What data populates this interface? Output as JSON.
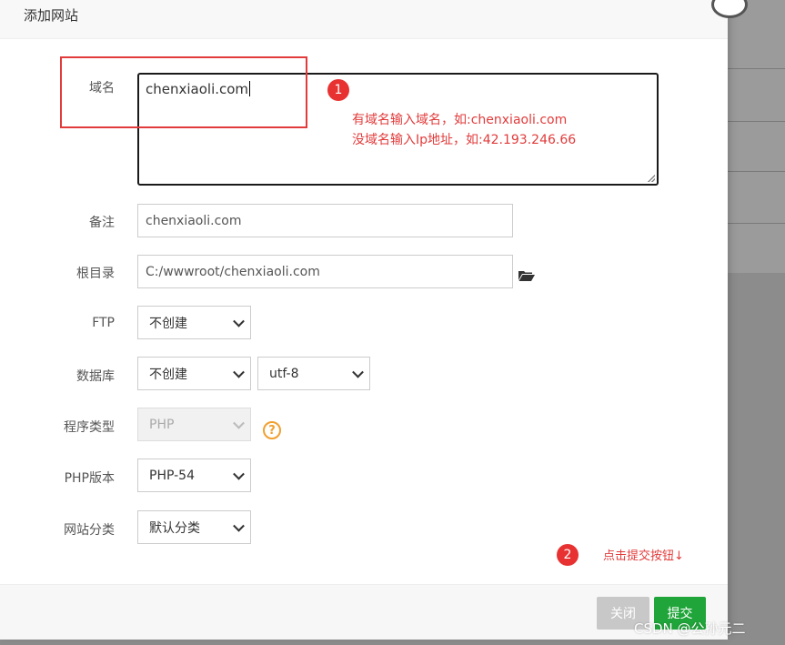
{
  "dialog": {
    "title": "添加网站"
  },
  "form": {
    "domain": {
      "label": "域名",
      "value": "chenxiaoli.com"
    },
    "remark": {
      "label": "备注",
      "value": "chenxiaoli.com"
    },
    "root": {
      "label": "根目录",
      "value": "C:/wwwroot/chenxiaoli.com"
    },
    "ftp": {
      "label": "FTP",
      "selected": "不创建"
    },
    "database": {
      "label": "数据库",
      "selected": "不创建",
      "charset": "utf-8"
    },
    "program_type": {
      "label": "程序类型",
      "selected": "PHP"
    },
    "php_version": {
      "label": "PHP版本",
      "selected": "PHP-54"
    },
    "category": {
      "label": "网站分类",
      "selected": "默认分类"
    }
  },
  "annotations": {
    "badge1": "1",
    "note1_line1": "有域名输入域名，如:chenxiaoli.com",
    "note1_line2": "没域名输入Ip地址，如:42.193.246.66",
    "badge2": "2",
    "note2": "点击提交按钮↓"
  },
  "footer": {
    "close_label": "关闭",
    "submit_label": "提交"
  },
  "watermark": "CSDN @公孙元二",
  "icons": {
    "folder": "folder-open-icon",
    "help": "help-circle-icon"
  },
  "colors": {
    "accent_green": "#20a53a",
    "annotation_red": "#e23b3b"
  }
}
